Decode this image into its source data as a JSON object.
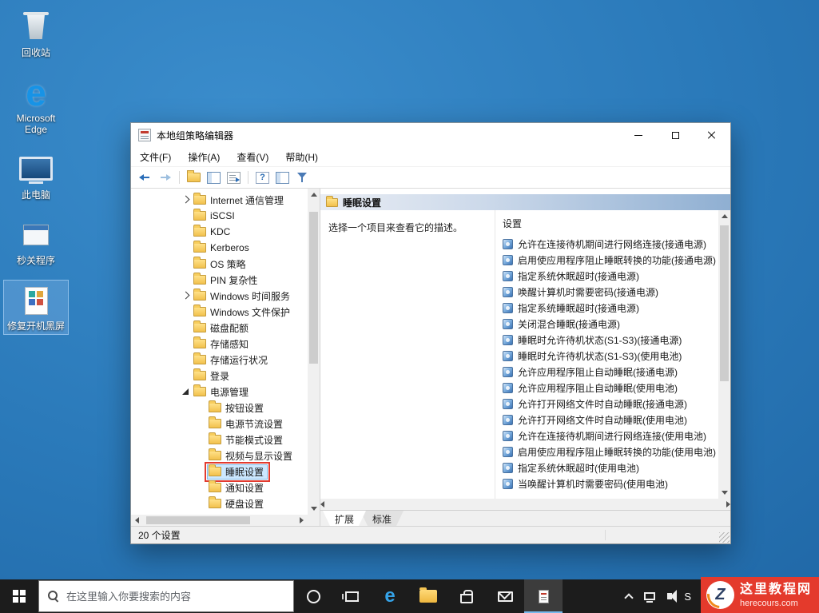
{
  "desktop": {
    "icons": [
      {
        "type": "recycle-bin",
        "label": "回收站",
        "selected": false
      },
      {
        "type": "edge",
        "label": "Microsoft Edge",
        "selected": false
      },
      {
        "type": "this-pc",
        "label": "此电脑",
        "selected": false
      },
      {
        "type": "app-window",
        "label": "秒关程序",
        "selected": false
      },
      {
        "type": "fix-doc",
        "label": "修复开机黑屏",
        "selected": true
      }
    ]
  },
  "window": {
    "title": "本地组策略编辑器",
    "menu": [
      "文件(F)",
      "操作(A)",
      "查看(V)",
      "帮助(H)"
    ],
    "tree": {
      "items": [
        {
          "label": "Internet 通信管理",
          "level": 1,
          "arrow": "right"
        },
        {
          "label": "iSCSI",
          "level": 1
        },
        {
          "label": "KDC",
          "level": 1
        },
        {
          "label": "Kerberos",
          "level": 1
        },
        {
          "label": "OS 策略",
          "level": 1
        },
        {
          "label": "PIN 复杂性",
          "level": 1
        },
        {
          "label": "Windows 时间服务",
          "level": 1,
          "arrow": "right"
        },
        {
          "label": "Windows 文件保护",
          "level": 1
        },
        {
          "label": "磁盘配额",
          "level": 1
        },
        {
          "label": "存储感知",
          "level": 1
        },
        {
          "label": "存储运行状况",
          "level": 1
        },
        {
          "label": "登录",
          "level": 1
        },
        {
          "label": "电源管理",
          "level": 1,
          "arrow": "down"
        },
        {
          "label": "按钮设置",
          "level": 2
        },
        {
          "label": "电源节流设置",
          "level": 2
        },
        {
          "label": "节能模式设置",
          "level": 2
        },
        {
          "label": "视频与显示设置",
          "level": 2
        },
        {
          "label": "睡眠设置",
          "level": 2,
          "selected": true,
          "annotated": true
        },
        {
          "label": "通知设置",
          "level": 2
        },
        {
          "label": "硬盘设置",
          "level": 2
        }
      ]
    },
    "right_pane": {
      "header": "睡眠设置",
      "description_hint": "选择一个项目来查看它的描述。",
      "settings_header": "设置",
      "settings": [
        "允许在连接待机期间进行网络连接(接通电源)",
        "启用使应用程序阻止睡眠转换的功能(接通电源)",
        "指定系统休眠超时(接通电源)",
        "唤醒计算机时需要密码(接通电源)",
        "指定系统睡眠超时(接通电源)",
        "关闭混合睡眠(接通电源)",
        "睡眠时允许待机状态(S1-S3)(接通电源)",
        "睡眠时允许待机状态(S1-S3)(使用电池)",
        "允许应用程序阻止自动睡眠(接通电源)",
        "允许应用程序阻止自动睡眠(使用电池)",
        "允许打开网络文件时自动睡眠(接通电源)",
        "允许打开网络文件时自动睡眠(使用电池)",
        "允许在连接待机期间进行网络连接(使用电池)",
        "启用使应用程序阻止睡眠转换的功能(使用电池)",
        "指定系统休眠超时(使用电池)",
        "当唤醒计算机时需要密码(使用电池)"
      ]
    },
    "tabs": [
      "扩展",
      "标准"
    ],
    "status": "20 个设置"
  },
  "taskbar": {
    "search_placeholder": "在这里输入你要搜索的内容",
    "tray_text": "S"
  },
  "watermark": {
    "logo_letter": "Z",
    "title": "这里教程网",
    "domain": "herecours.com"
  }
}
